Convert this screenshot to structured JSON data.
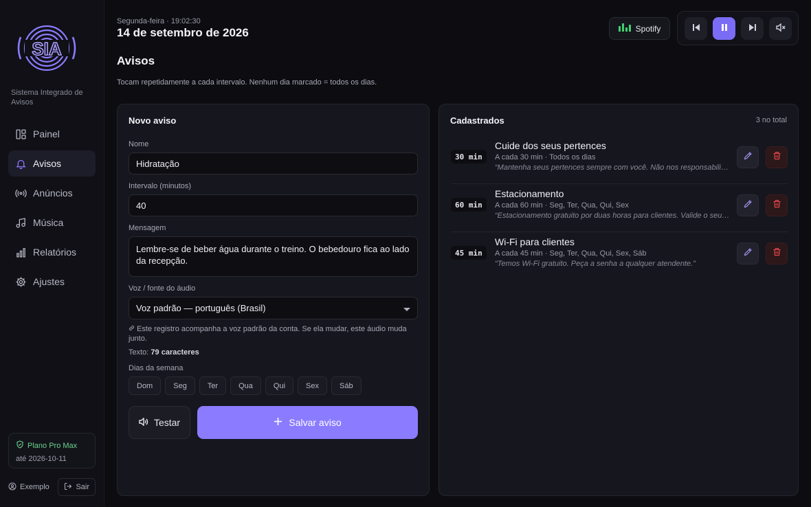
{
  "app": {
    "logo_text": "SIA",
    "tagline": "Sistema Integrado de Avisos"
  },
  "sidebar": {
    "items": [
      {
        "label": "Painel",
        "icon": "dashboard-icon"
      },
      {
        "label": "Avisos",
        "icon": "bell-icon",
        "active": true
      },
      {
        "label": "Anúncios",
        "icon": "broadcast-icon"
      },
      {
        "label": "Música",
        "icon": "music-icon"
      },
      {
        "label": "Relatórios",
        "icon": "bar-chart-icon"
      },
      {
        "label": "Ajustes",
        "icon": "gear-icon"
      }
    ],
    "plan": {
      "name": "Plano Pro Max",
      "until": "até 2026-10-11"
    },
    "user": "Exemplo",
    "logout": "Sair"
  },
  "header": {
    "datetime_sub": "Segunda-feira · 19:02:30",
    "date": "14 de setembro de 2026",
    "spotify_label": "Spotify"
  },
  "page": {
    "title": "Avisos",
    "description": "Tocam repetidamente a cada intervalo. Nenhum dia marcado = todos os dias."
  },
  "form": {
    "title": "Novo aviso",
    "name_label": "Nome",
    "name_value": "Hidratação",
    "interval_label": "Intervalo (minutos)",
    "interval_value": "40",
    "message_label": "Mensagem",
    "message_value": "Lembre-se de beber água durante o treino. O bebedouro fica ao lado da recepção.",
    "voice_label": "Voz / fonte do áudio",
    "voice_value": "Voz padrão — português (Brasil)",
    "voice_note": "Este registro acompanha a voz padrão da conta. Se ela mudar, este áudio muda junto.",
    "char_prefix": "Texto:",
    "char_count": "79 caracteres",
    "days_label": "Dias da semana",
    "days": [
      "Dom",
      "Seg",
      "Ter",
      "Qua",
      "Qui",
      "Sex",
      "Sáb"
    ],
    "test_label": "Testar",
    "save_label": "Salvar aviso"
  },
  "list": {
    "title": "Cadastrados",
    "count": "3 no total",
    "items": [
      {
        "badge": "30 min",
        "title": "Cuide dos seus pertences",
        "meta": "A cada 30 min · Todos os dias",
        "message": "“Mantenha seus pertences sempre com você. Não nos responsabilizamos por objetos esquecidos.”"
      },
      {
        "badge": "60 min",
        "title": "Estacionamento",
        "meta": "A cada 60 min · Seg, Ter, Qua, Qui, Sex",
        "message": "“Estacionamento gratuito por duas horas para clientes. Valide o seu ticket no caixa.”"
      },
      {
        "badge": "45 min",
        "title": "Wi-Fi para clientes",
        "meta": "A cada 45 min · Seg, Ter, Qua, Qui, Sex, Sáb",
        "message": "“Temos Wi-Fi gratuito. Peça a senha a qualquer atendente.”"
      }
    ]
  },
  "colors": {
    "accent": "#8b7cff",
    "success": "#6ad48e",
    "danger": "#e5484d",
    "background": "#0c0c11"
  }
}
